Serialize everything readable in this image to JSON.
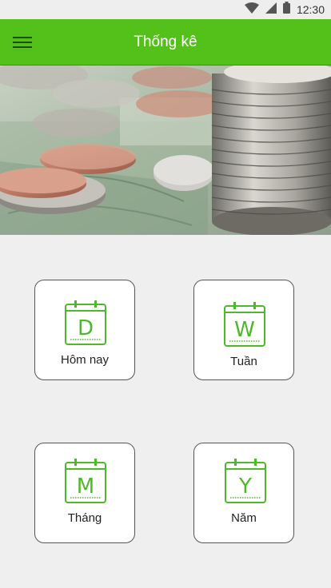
{
  "status_bar": {
    "time": "12:30",
    "icons": [
      "wifi-icon",
      "cell-signal-icon",
      "battery-icon"
    ]
  },
  "app_bar": {
    "title": "Thống kê",
    "menu_icon": "hamburger-menu-icon",
    "color": "#54c11b"
  },
  "banner": {
    "image": "coins-and-banknotes-photo"
  },
  "cards": [
    {
      "letter": "D",
      "label": "Hôm nay"
    },
    {
      "letter": "W",
      "label": "Tuần"
    },
    {
      "letter": "M",
      "label": "Tháng"
    },
    {
      "letter": "Y",
      "label": "Năm"
    }
  ],
  "colors": {
    "accent": "#54c11b",
    "icon_green": "#4cb82a",
    "background": "#efefef"
  }
}
